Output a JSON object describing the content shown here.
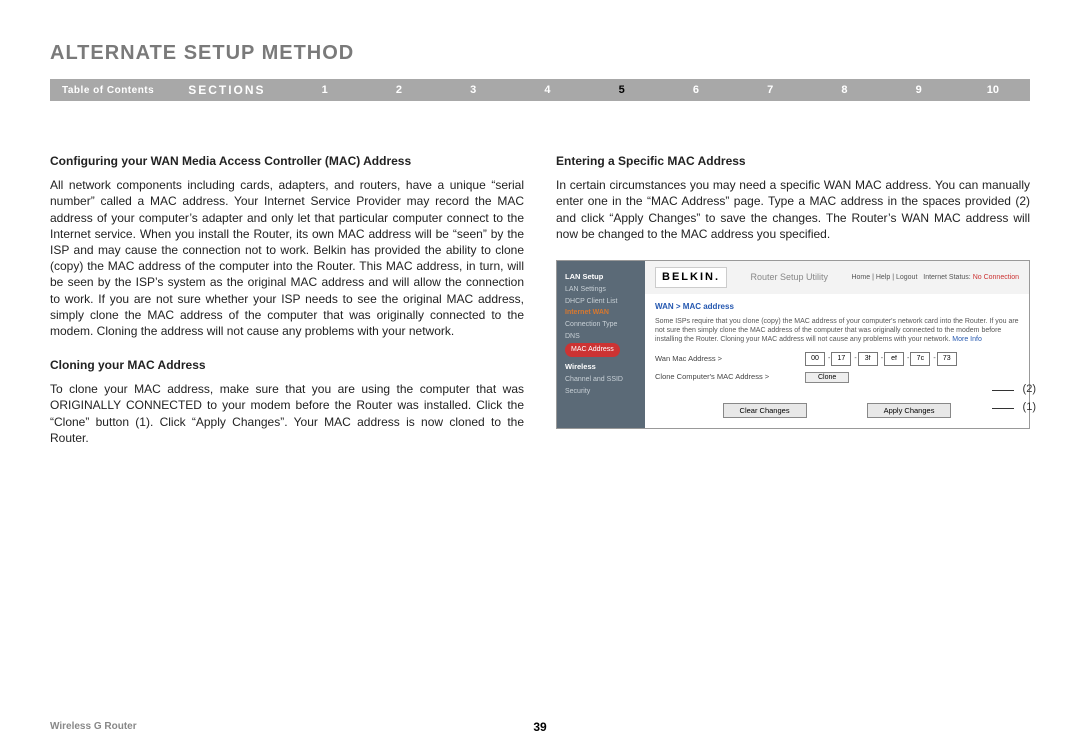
{
  "title": "ALTERNATE SETUP METHOD",
  "nav": {
    "toc": "Table of Contents",
    "sections": "SECTIONS",
    "nums": [
      "1",
      "2",
      "3",
      "4",
      "5",
      "6",
      "7",
      "8",
      "9",
      "10"
    ],
    "active": "5"
  },
  "left": {
    "h1": "Configuring your WAN Media Access Controller (MAC) Address",
    "p1": "All network components including cards, adapters, and routers, have a unique “serial number” called a MAC address. Your Internet Service Provider may record the MAC address of your computer’s adapter and only let that particular computer connect to the Internet service. When you install the Router, its own MAC address will be “seen” by the ISP and may cause the connection not to work. Belkin has provided the ability to clone (copy) the MAC address of the computer into the Router. This MAC address, in turn, will be seen by the ISP’s system as the original MAC address and will allow the connection to work. If you are not sure whether your ISP needs to see the original MAC address, simply clone the MAC address of the computer that was originally connected to the modem. Cloning the address will not cause any problems with your network.",
    "h2": "Cloning your MAC Address",
    "p2": "To clone your MAC address, make sure that you are using the computer that was ORIGINALLY CONNECTED to your modem before the Router was installed. Click the “Clone” button (1). Click “Apply Changes”. Your MAC address is now cloned to the Router."
  },
  "right": {
    "h1": "Entering a Specific MAC Address",
    "p1": "In certain circumstances you may need a specific WAN MAC address. You can manually enter one in the “MAC Address” page. Type a MAC address in the spaces provided (2) and click “Apply Changes” to save the changes. The Router’s WAN MAC address will now be changed to the MAC address you specified."
  },
  "fig": {
    "logo": "BELKIN.",
    "util": "Router Setup Utility",
    "links": {
      "home": "Home",
      "help": "Help",
      "logout": "Logout",
      "status_lbl": "Internet Status:",
      "status_val": "No Connection"
    },
    "side": {
      "lan_setup": "LAN Setup",
      "lan_settings": "LAN Settings",
      "dhcp": "DHCP Client List",
      "internet_wan": "Internet WAN",
      "conn_type": "Connection Type",
      "dns": "DNS",
      "mac_addr": "MAC Address",
      "wireless": "Wireless",
      "chan_ssid": "Channel and SSID",
      "security": "Security"
    },
    "crumb": "WAN > MAC address",
    "desc": "Some ISPs require that you clone (copy) the MAC address of your computer's network card into the Router. If you are not sure then simply clone the MAC address of the computer that was originally connected to the modem before installing the Router. Cloning your MAC address will not cause any problems with your network.",
    "more": "More Info",
    "row1_lbl": "Wan Mac Address >",
    "mac": [
      "00",
      "17",
      "3f",
      "ef",
      "7c",
      "73"
    ],
    "row2_lbl": "Clone Computer's MAC Address >",
    "clone_btn": "Clone",
    "clear_btn": "Clear Changes",
    "apply_btn": "Apply Changes"
  },
  "callouts": {
    "c1": "(1)",
    "c2": "(2)"
  },
  "footer": {
    "product": "Wireless G Router",
    "page": "39"
  }
}
